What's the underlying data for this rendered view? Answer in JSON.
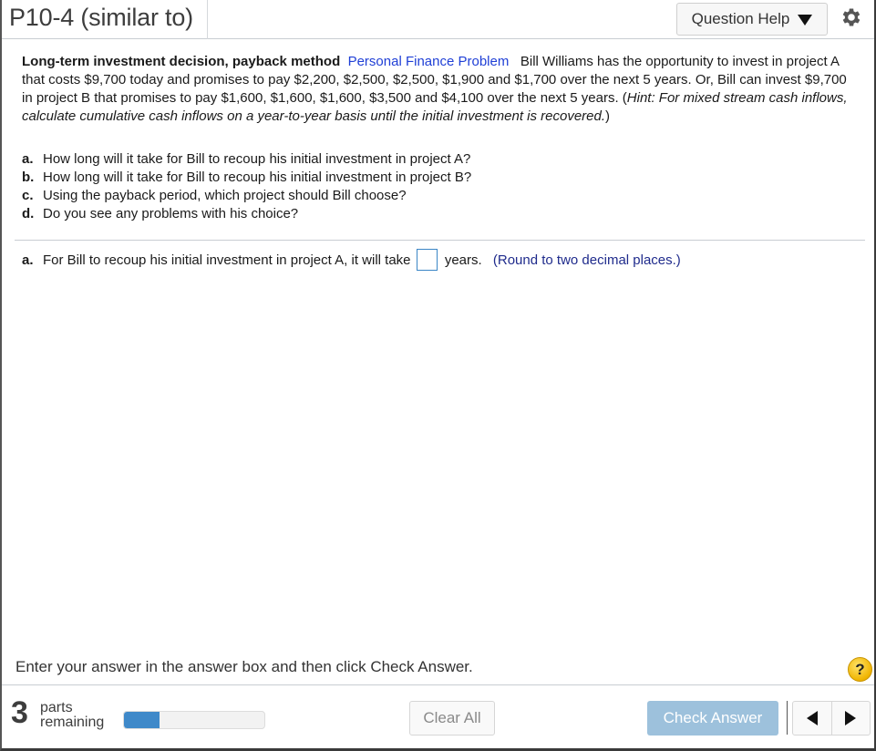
{
  "header": {
    "title": "P10-4 (similar to)",
    "question_help_label": "Question Help",
    "settings_icon": "gear-icon"
  },
  "problem": {
    "heading": "Long-term investment decision, payback method",
    "category": "Personal Finance Problem",
    "body": "Bill Williams has the opportunity to invest in project A that costs $9,700 today and promises to pay $2,200, $2,500, $2,500, $1,900 and $1,700 over the next 5 years.  Or, Bill can invest $9,700 in project B that promises to pay $1,600, $1,600, $1,600, $3,500 and $4,100 over the next 5 years.",
    "hint_open": "(",
    "hint": "Hint: For mixed stream cash inflows, calculate cumulative cash inflows on a year-to-year basis until the initial investment is recovered.",
    "hint_close": ")",
    "parts": [
      {
        "label": "a.",
        "text": "How long will it take for Bill to recoup his initial investment in project A?"
      },
      {
        "label": "b.",
        "text": "How long will it take for Bill to recoup his initial investment in project B?"
      },
      {
        "label": "c.",
        "text": "Using the payback period, which project should Bill choose?"
      },
      {
        "label": "d.",
        "text": "Do you see any problems with his choice?"
      }
    ]
  },
  "answer": {
    "label": "a.",
    "prefix": "For Bill to recoup his initial investment in project A, it will take",
    "value": "",
    "suffix": "years.",
    "note": "(Round to two decimal places.)"
  },
  "footer": {
    "instructions": "Enter your answer in the answer box and then click Check Answer.",
    "help_icon": "?",
    "parts_remaining_count": "3",
    "parts_remaining_word1": "parts",
    "parts_remaining_word2": "remaining",
    "progress_fraction": 0.25,
    "clear_all_label": "Clear All",
    "check_answer_label": "Check Answer"
  },
  "colors": {
    "link_blue": "#1f3fd6",
    "note_blue": "#1f2b8c",
    "progress_fill": "#3f89c9",
    "check_button_bg": "#9dc1dc",
    "help_bubble": "#f0b400"
  }
}
